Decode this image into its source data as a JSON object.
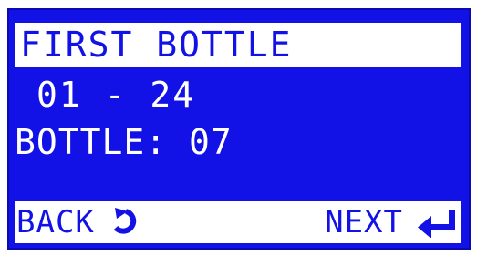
{
  "title": "FIRST BOTTLE",
  "range": "01 - 24",
  "bottle_line": "BOTTLE: 07",
  "footer": {
    "back_label": "BACK",
    "next_label": "NEXT",
    "back_icon": "undo-arrow-icon",
    "next_icon": "enter-return-icon"
  },
  "colors": {
    "screen_bg": "#1212e6",
    "text": "#ffffff",
    "bar_bg": "#ffffff",
    "bar_text": "#1212e6"
  }
}
